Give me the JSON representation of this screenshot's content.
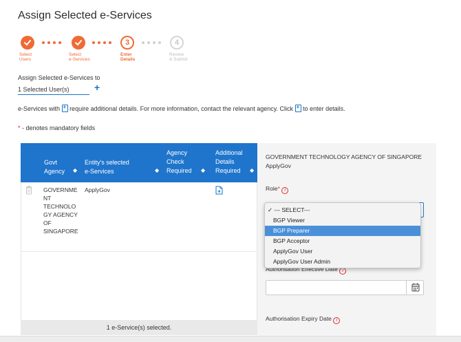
{
  "page": {
    "title": "Assign Selected e-Services"
  },
  "stepper": {
    "steps": [
      {
        "number": "1",
        "label_line1": "Select",
        "label_line2": "Users",
        "state": "done"
      },
      {
        "number": "2",
        "label_line1": "Select",
        "label_line2": "e-Services",
        "state": "done"
      },
      {
        "number": "3",
        "label_line1": "Enter",
        "label_line2": "Details",
        "state": "current"
      },
      {
        "number": "4",
        "label_line1": "Review",
        "label_line2": "& Submit",
        "state": "future"
      }
    ],
    "accent_color": "#f06a35"
  },
  "assign": {
    "label": "Assign Selected e-Services to",
    "selected_users": "1 Selected User(s)",
    "add_symbol": "+"
  },
  "notice": {
    "part1": "e-Services with",
    "part2": "require additional details. For more information, contact the relevant agency. Click",
    "part3": "to enter details."
  },
  "mandatory": {
    "star": "*",
    "text": "- denotes mandatory fields"
  },
  "table": {
    "headers": {
      "agency_line1": "Govt",
      "agency_line2": "Agency",
      "services_line1": "Entity's selected",
      "services_line2": "e-Services",
      "check_line1": "Agency",
      "check_line2": "Check",
      "check_line3": "Required",
      "details_line1": "Additional",
      "details_line2": "Details",
      "details_line3": "Required"
    },
    "rows": [
      {
        "agency_lines": [
          "GOVERNME",
          "NT",
          "TECHNOLO",
          "GY AGENCY",
          "OF",
          "SINGAPORE"
        ],
        "service": "ApplyGov"
      }
    ],
    "footer": "1 e-Service(s) selected.",
    "header_color": "#1f75cc"
  },
  "details_panel": {
    "agency_name": "GOVERNMENT TECHNOLOGY AGENCY OF SINGAPORE",
    "service_name": "ApplyGov",
    "role_label": "Role",
    "required_star": "*",
    "info_symbol": "i",
    "role_options": [
      "--- SELECT---",
      "BGP Viewer",
      "BGP Preparer",
      "BGP Acceptor",
      "ApplyGov User",
      "ApplyGov User Admin"
    ],
    "role_checked": "--- SELECT---",
    "role_highlighted": "BGP Preparer",
    "effective_date_label": "Authorisation Effective Date",
    "expiry_date_label": "Authorisation Expiry Date"
  }
}
